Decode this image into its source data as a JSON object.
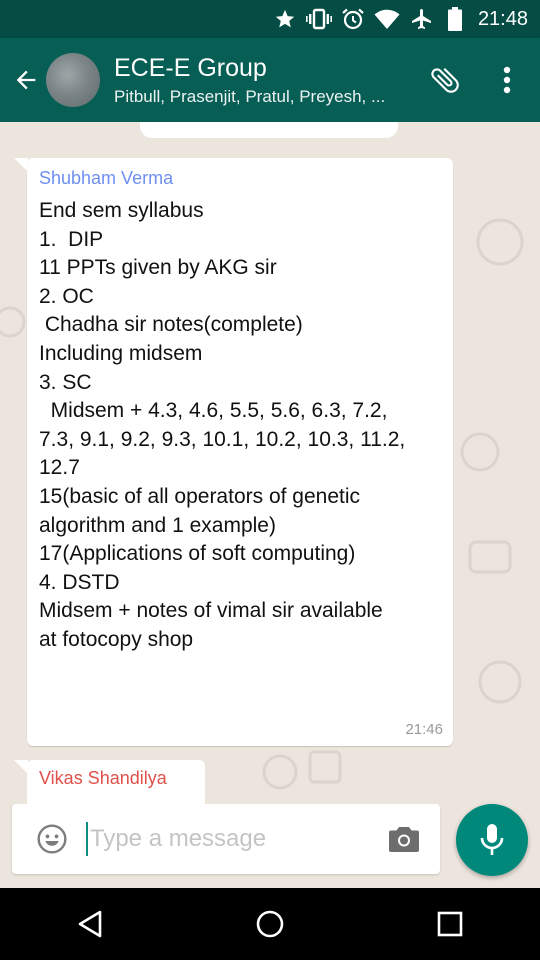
{
  "status_bar": {
    "time": "21:48",
    "icons": [
      "star-icon",
      "vibrate-icon",
      "alarm-icon",
      "wifi-icon",
      "airplane-icon",
      "battery-icon"
    ]
  },
  "header": {
    "title": "ECE-E Group",
    "subtitle": "Pitbull, Prasenjit, Pratul, Preyesh, ...",
    "icons": [
      "back-arrow-icon",
      "attach-icon",
      "more-vert-icon"
    ],
    "colors": {
      "status_bar": "#054d44",
      "app_bar": "#075e54"
    }
  },
  "messages": [
    {
      "sender": "Shubham Verma",
      "sender_color": "#6f8ff0",
      "lines": [
        "End sem syllabus",
        "1.  DIP",
        "11 PPTs given by AKG sir",
        "",
        "2. OC",
        " Chadha sir notes(complete)",
        "Including midsem",
        "",
        "3. SC",
        "  Midsem + 4.3, 4.6, 5.5, 5.6, 6.3, 7.2,",
        "7.3, 9.1, 9.2, 9.3, 10.1, 10.2, 10.3, 11.2,",
        "12.7",
        "15(basic of all operators of genetic",
        "algorithm and 1 example)",
        "17(Applications of soft computing)",
        "",
        "4. DSTD",
        "Midsem + notes of vimal sir available",
        "at fotocopy shop"
      ],
      "time": "21:46"
    },
    {
      "sender": "Vikas Shandilya",
      "sender_color": "#e0504a"
    }
  ],
  "composer": {
    "placeholder": "Type a message",
    "icons": [
      "emoji-icon",
      "camera-icon",
      "mic-icon"
    ],
    "accent": "#00897b"
  },
  "nav": {
    "icons": [
      "nav-back-icon",
      "nav-home-icon",
      "nav-recents-icon"
    ]
  }
}
